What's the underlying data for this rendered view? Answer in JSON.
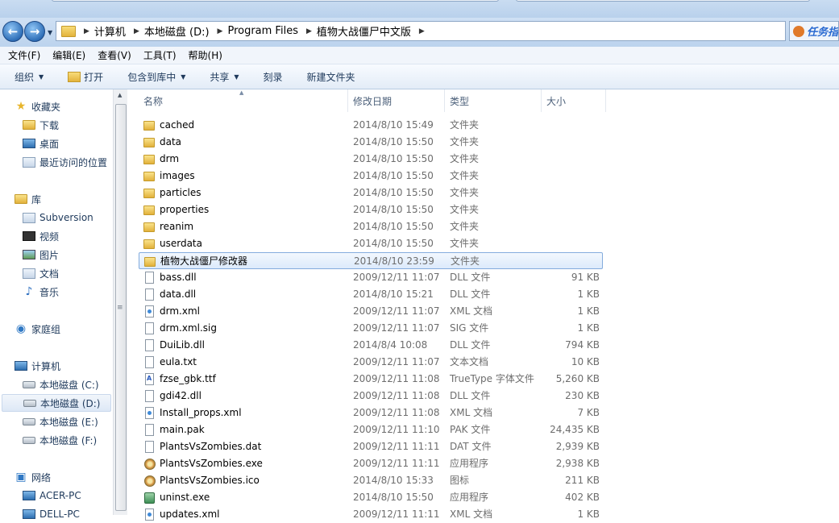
{
  "window": {
    "faded_title": ""
  },
  "address": {
    "crumbs": [
      "计算机",
      "本地磁盘 (D:)",
      "Program Files",
      "植物大战僵尸中文版"
    ],
    "task_button": "任务指"
  },
  "menu": [
    "文件(F)",
    "编辑(E)",
    "查看(V)",
    "工具(T)",
    "帮助(H)"
  ],
  "toolbar": {
    "organize": "组织",
    "open": "打开",
    "include_in_library": "包含到库中",
    "share": "共享",
    "burn": "刻录",
    "new_folder": "新建文件夹"
  },
  "nav": {
    "favorites": "收藏夹",
    "favorites_items": [
      "下载",
      "桌面",
      "最近访问的位置"
    ],
    "libraries": "库",
    "library_items": [
      "Subversion",
      "视频",
      "图片",
      "文档",
      "音乐"
    ],
    "homegroup": "家庭组",
    "computer": "计算机",
    "drives": [
      "本地磁盘 (C:)",
      "本地磁盘 (D:)",
      "本地磁盘 (E:)",
      "本地磁盘 (F:)"
    ],
    "network": "网络",
    "network_items": [
      "ACER-PC",
      "DELL-PC"
    ]
  },
  "columns": {
    "name": "名称",
    "modified": "修改日期",
    "type": "类型",
    "size": "大小"
  },
  "files": [
    {
      "icon": "folder",
      "name": "cached",
      "date": "2014/8/10 15:49",
      "type": "文件夹",
      "size": ""
    },
    {
      "icon": "folder",
      "name": "data",
      "date": "2014/8/10 15:50",
      "type": "文件夹",
      "size": ""
    },
    {
      "icon": "folder",
      "name": "drm",
      "date": "2014/8/10 15:50",
      "type": "文件夹",
      "size": ""
    },
    {
      "icon": "folder",
      "name": "images",
      "date": "2014/8/10 15:50",
      "type": "文件夹",
      "size": ""
    },
    {
      "icon": "folder",
      "name": "particles",
      "date": "2014/8/10 15:50",
      "type": "文件夹",
      "size": ""
    },
    {
      "icon": "folder",
      "name": "properties",
      "date": "2014/8/10 15:50",
      "type": "文件夹",
      "size": ""
    },
    {
      "icon": "folder",
      "name": "reanim",
      "date": "2014/8/10 15:50",
      "type": "文件夹",
      "size": ""
    },
    {
      "icon": "folder",
      "name": "userdata",
      "date": "2014/8/10 15:50",
      "type": "文件夹",
      "size": ""
    },
    {
      "icon": "folder",
      "name": "植物大战僵尸修改器",
      "date": "2014/8/10 23:59",
      "type": "文件夹",
      "size": "",
      "selected": true
    },
    {
      "icon": "doc",
      "name": "bass.dll",
      "date": "2009/12/11 11:07",
      "type": "DLL 文件",
      "size": "91 KB"
    },
    {
      "icon": "doc",
      "name": "data.dll",
      "date": "2014/8/10 15:21",
      "type": "DLL 文件",
      "size": "1 KB"
    },
    {
      "icon": "xml",
      "name": "drm.xml",
      "date": "2009/12/11 11:07",
      "type": "XML 文档",
      "size": "1 KB"
    },
    {
      "icon": "doc",
      "name": "drm.xml.sig",
      "date": "2009/12/11 11:07",
      "type": "SIG 文件",
      "size": "1 KB"
    },
    {
      "icon": "doc",
      "name": "DuiLib.dll",
      "date": "2014/8/4 10:08",
      "type": "DLL 文件",
      "size": "794 KB"
    },
    {
      "icon": "doc",
      "name": "eula.txt",
      "date": "2009/12/11 11:07",
      "type": "文本文档",
      "size": "10 KB"
    },
    {
      "icon": "font",
      "name": "fzse_gbk.ttf",
      "date": "2009/12/11 11:08",
      "type": "TrueType 字体文件",
      "size": "5,260 KB"
    },
    {
      "icon": "doc",
      "name": "gdi42.dll",
      "date": "2009/12/11 11:08",
      "type": "DLL 文件",
      "size": "230 KB"
    },
    {
      "icon": "xml",
      "name": "Install_props.xml",
      "date": "2009/12/11 11:08",
      "type": "XML 文档",
      "size": "7 KB"
    },
    {
      "icon": "doc",
      "name": "main.pak",
      "date": "2009/12/11 11:10",
      "type": "PAK 文件",
      "size": "24,435 KB"
    },
    {
      "icon": "doc",
      "name": "PlantsVsZombies.dat",
      "date": "2009/12/11 11:11",
      "type": "DAT 文件",
      "size": "2,939 KB"
    },
    {
      "icon": "exe",
      "name": "PlantsVsZombies.exe",
      "date": "2009/12/11 11:11",
      "type": "应用程序",
      "size": "2,938 KB"
    },
    {
      "icon": "exe",
      "name": "PlantsVsZombies.ico",
      "date": "2014/8/10 15:33",
      "type": "图标",
      "size": "211 KB"
    },
    {
      "icon": "uninst",
      "name": "uninst.exe",
      "date": "2014/8/10 15:50",
      "type": "应用程序",
      "size": "402 KB"
    },
    {
      "icon": "xml",
      "name": "updates.xml",
      "date": "2009/12/11 11:11",
      "type": "XML 文档",
      "size": "1 KB"
    }
  ]
}
